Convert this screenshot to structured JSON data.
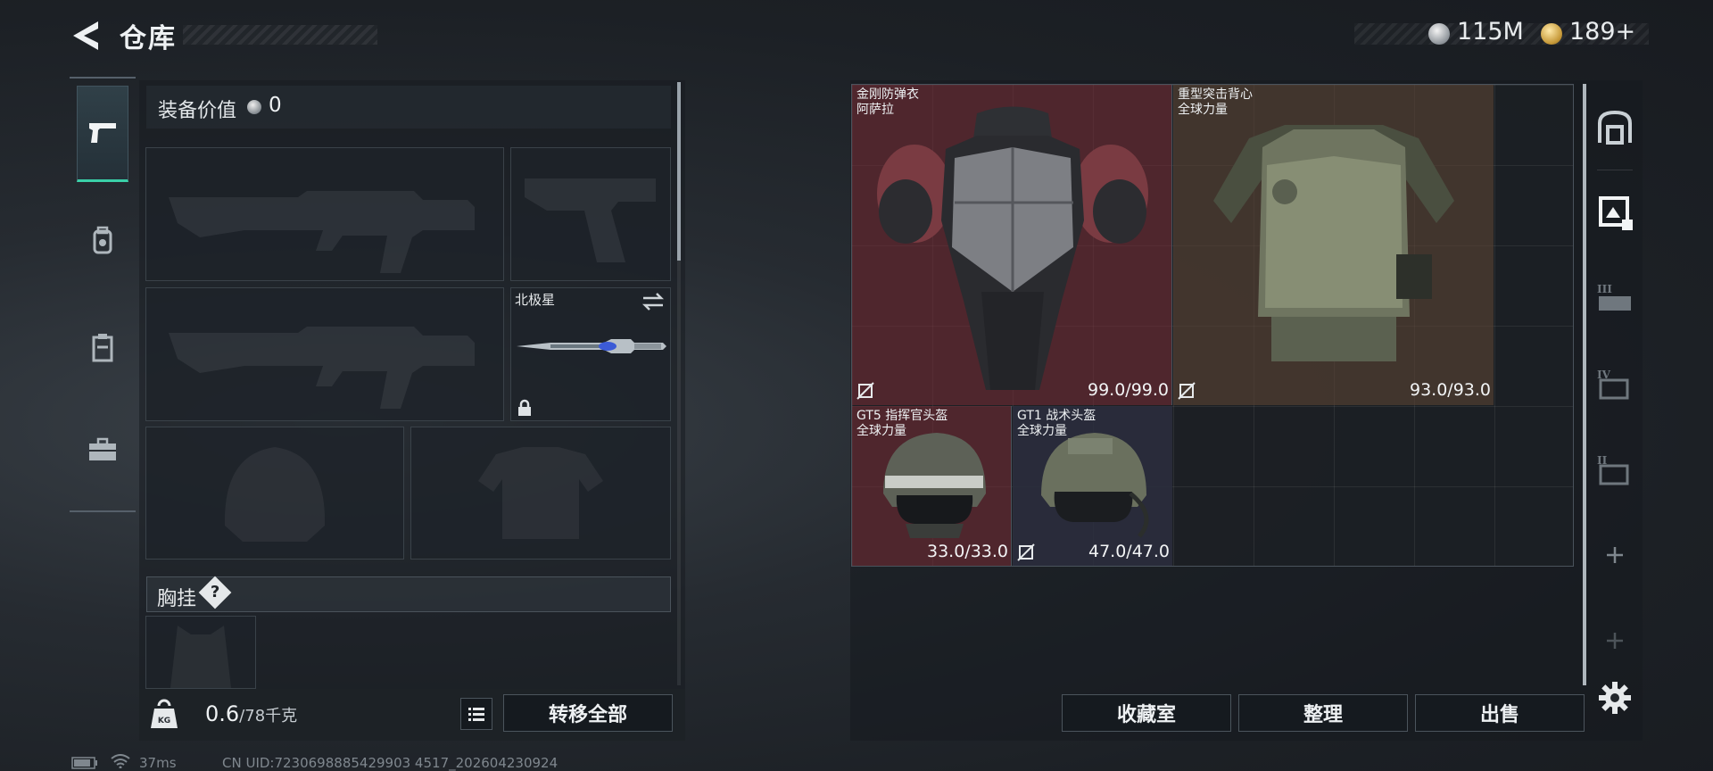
{
  "header": {
    "title": "仓库",
    "currency_silver": "115M",
    "currency_gold": "189+"
  },
  "left": {
    "value_label": "装备价值",
    "value": "0",
    "melee_slot_name": "北极星",
    "rig_label": "胸挂",
    "rig_help": "?",
    "weight_current": "0.6",
    "weight_max": "/78千克",
    "transfer_all": "转移全部"
  },
  "nav": {
    "items": [
      "weapon-tab",
      "backpack-tab",
      "rig-tab",
      "case-tab"
    ]
  },
  "grid": {
    "items": [
      {
        "name": "金刚防弹衣",
        "sub": "阿萨拉",
        "durability": "99.0/99.0"
      },
      {
        "name": "重型突击背心",
        "sub": "全球力量",
        "durability": "93.0/93.0"
      },
      {
        "name": "GT5 指挥官头盔",
        "sub": "全球力量",
        "durability": "33.0/33.0"
      },
      {
        "name": "GT1 战术头盔",
        "sub": "全球力量",
        "durability": "47.0/47.0"
      }
    ]
  },
  "actions": {
    "collection": "收藏室",
    "organize": "整理",
    "sell": "出售"
  },
  "status": {
    "ping": "37ms",
    "uid": "CN UID:7230698885429903 4517_202604230924"
  }
}
